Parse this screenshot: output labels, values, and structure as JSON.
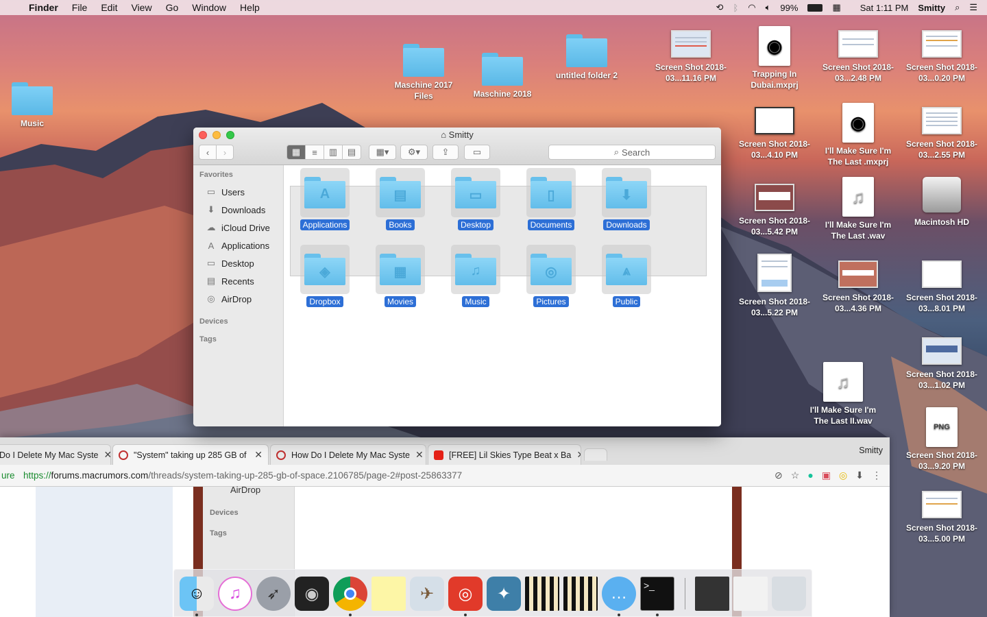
{
  "menubar": {
    "app": "Finder",
    "items": [
      "File",
      "Edit",
      "View",
      "Go",
      "Window",
      "Help"
    ],
    "battery": "99%",
    "clock": "Sat 1:11 PM",
    "user": "Smitty"
  },
  "desktop": {
    "icons": [
      {
        "label": "Music"
      },
      {
        "label": "Maschine 2017 Files"
      },
      {
        "label": "Maschine 2018"
      },
      {
        "label": "untitled folder 2"
      },
      {
        "label": "Screen Shot 2018-03...11.16 PM"
      },
      {
        "label": "Trapping In Dubai.mxprj"
      },
      {
        "label": "Screen Shot 2018-03...2.48 PM"
      },
      {
        "label": "Screen Shot 2018-03...0.20 PM"
      },
      {
        "label": "Screen Shot 2018-03...4.10 PM"
      },
      {
        "label": "I'll Make Sure I'm The Last .mxprj"
      },
      {
        "label": "Screen Shot 2018-03...2.55 PM"
      },
      {
        "label": "Screen Shot 2018-03...5.42 PM"
      },
      {
        "label": "I'll Make Sure I'm The Last .wav"
      },
      {
        "label": "Macintosh HD"
      },
      {
        "label": "Screen Shot 2018-03...5.22 PM"
      },
      {
        "label": "Screen Shot 2018-03...4.36 PM"
      },
      {
        "label": "Screen Shot 2018-03...8.01 PM"
      },
      {
        "label": "Screen Shot 2018-03...1.02 PM"
      },
      {
        "label": "I'll Make Sure I'm The Last II.wav"
      },
      {
        "label": "Screen Shot 2018-03...9.20 PM"
      },
      {
        "label": "Screen Shot 2018-03...5.00 PM"
      }
    ]
  },
  "finder": {
    "title": "Smitty",
    "search_placeholder": "Search",
    "sidebar": {
      "favorites_header": "Favorites",
      "favorites": [
        "Users",
        "Downloads",
        "iCloud Drive",
        "Applications",
        "Desktop",
        "Recents",
        "AirDrop"
      ],
      "devices_header": "Devices",
      "tags_header": "Tags"
    },
    "items": [
      "Applications",
      "Books",
      "Desktop",
      "Documents",
      "Downloads",
      "Dropbox",
      "Movies",
      "Music",
      "Pictures",
      "Public"
    ],
    "item_glyphs": [
      "A",
      "▤",
      "▭",
      "▯",
      "⬇",
      "◈",
      "▦",
      "♫",
      "◎",
      "⩓"
    ]
  },
  "browser": {
    "tabs": [
      {
        "title": "Do I Delete My Mac Syste"
      },
      {
        "title": "\"System\" taking up 285 GB of"
      },
      {
        "title": "How Do I Delete My Mac Syste"
      },
      {
        "title": "[FREE] Lil Skies Type Beat x Ba"
      }
    ],
    "profile": "Smitty",
    "url_prefix": "ure",
    "url_scheme": "https://",
    "url_domain": "forums.macrumors.com",
    "url_path": "/threads/system-taking-up-285-gb-of-space.2106785/page-2#post-25863377",
    "page": {
      "airdrop": "AirDrop",
      "devices": "Devices",
      "tags": "Tags"
    }
  },
  "dock": {
    "apps": [
      "finder-icon",
      "itunes-icon",
      "launchpad-icon",
      "logic-icon",
      "chrome-icon",
      "notes-icon",
      "preview-icon",
      "maschine-icon",
      "native-access-icon",
      "piano-icon",
      "piano-2-icon",
      "messages-icon",
      "terminal-icon",
      "screenshot-stack-icon",
      "documents-stack-icon",
      "trash-icon"
    ]
  },
  "colors": {
    "selection": "#2d6fd6",
    "folder": "#62bdea",
    "accent_green": "#198b2e"
  }
}
